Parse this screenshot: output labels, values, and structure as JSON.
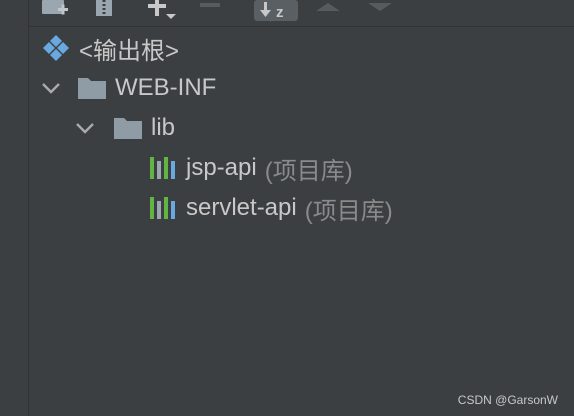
{
  "tree": {
    "root": {
      "label": "<输出根>",
      "icon": "output-root-icon"
    },
    "items": [
      {
        "label": "WEB-INF",
        "icon": "folder-icon",
        "expanded": true
      },
      {
        "label": "lib",
        "icon": "folder-icon",
        "expanded": true
      },
      {
        "label": "jsp-api",
        "suffix": "(项目库)",
        "icon": "library-icon"
      },
      {
        "label": "servlet-api",
        "suffix": "(项目库)",
        "icon": "library-icon"
      }
    ]
  },
  "toolbar": {
    "icons": [
      "add-folder-icon",
      "archive-icon",
      "add-dropdown-icon",
      "remove-icon",
      "sort-alpha-icon",
      "move-up-icon",
      "move-down-icon"
    ]
  },
  "watermark": "CSDN @GarsonW",
  "colors": {
    "background": "#3c3f41",
    "text": "#c8c8c8",
    "muted": "#8a8a8a",
    "folder": "#8f9ba5",
    "sort_active_bg": "#5a5f63"
  }
}
